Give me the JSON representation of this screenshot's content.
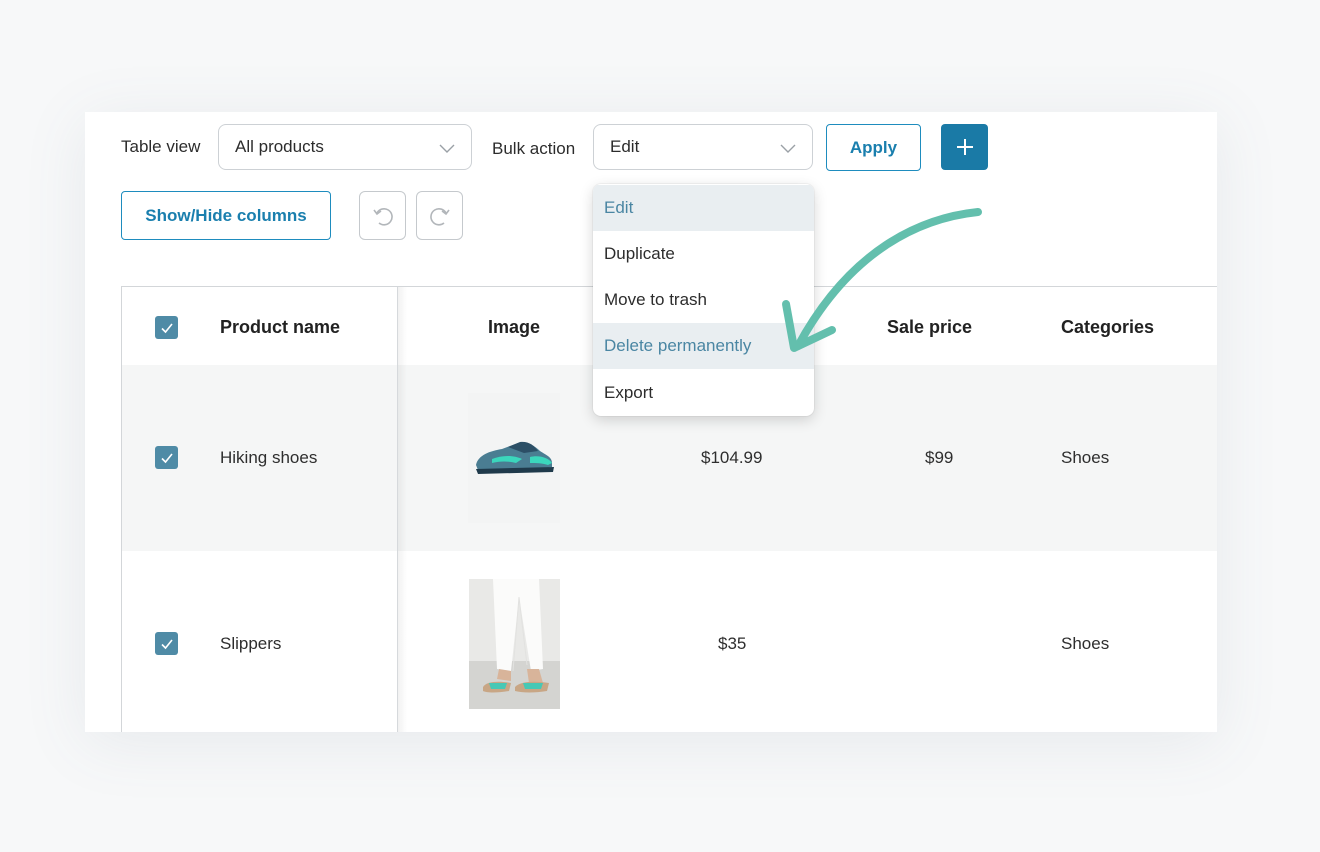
{
  "toolbar": {
    "table_view_label": "Table view",
    "table_view_value": "All products",
    "bulk_action_label": "Bulk action",
    "bulk_action_value": "Edit",
    "apply_label": "Apply",
    "add_icon": "plus-icon",
    "show_hide_label": "Show/Hide columns",
    "undo_icon": "undo-icon",
    "redo_icon": "redo-icon"
  },
  "bulk_menu": {
    "options": [
      "Edit",
      "Duplicate",
      "Move to trash",
      "Delete permanently",
      "Export"
    ],
    "highlighted": [
      "Edit",
      "Delete permanently"
    ]
  },
  "table": {
    "columns": [
      "Product name",
      "Image",
      "Sale price",
      "Categories"
    ],
    "rows": [
      {
        "checked": true,
        "name": "Hiking shoes",
        "price": "$104.99",
        "sale_price": "$99",
        "category": "Shoes",
        "image": "hiking-shoe"
      },
      {
        "checked": true,
        "name": "Slippers",
        "price": "$35",
        "sale_price": "",
        "category": "Shoes",
        "image": "slippers"
      }
    ]
  },
  "colors": {
    "accent": "#1a7aa6",
    "checkbox": "#4f8ba6",
    "arrow": "#63bfad",
    "highlight": "#e9eef1"
  }
}
